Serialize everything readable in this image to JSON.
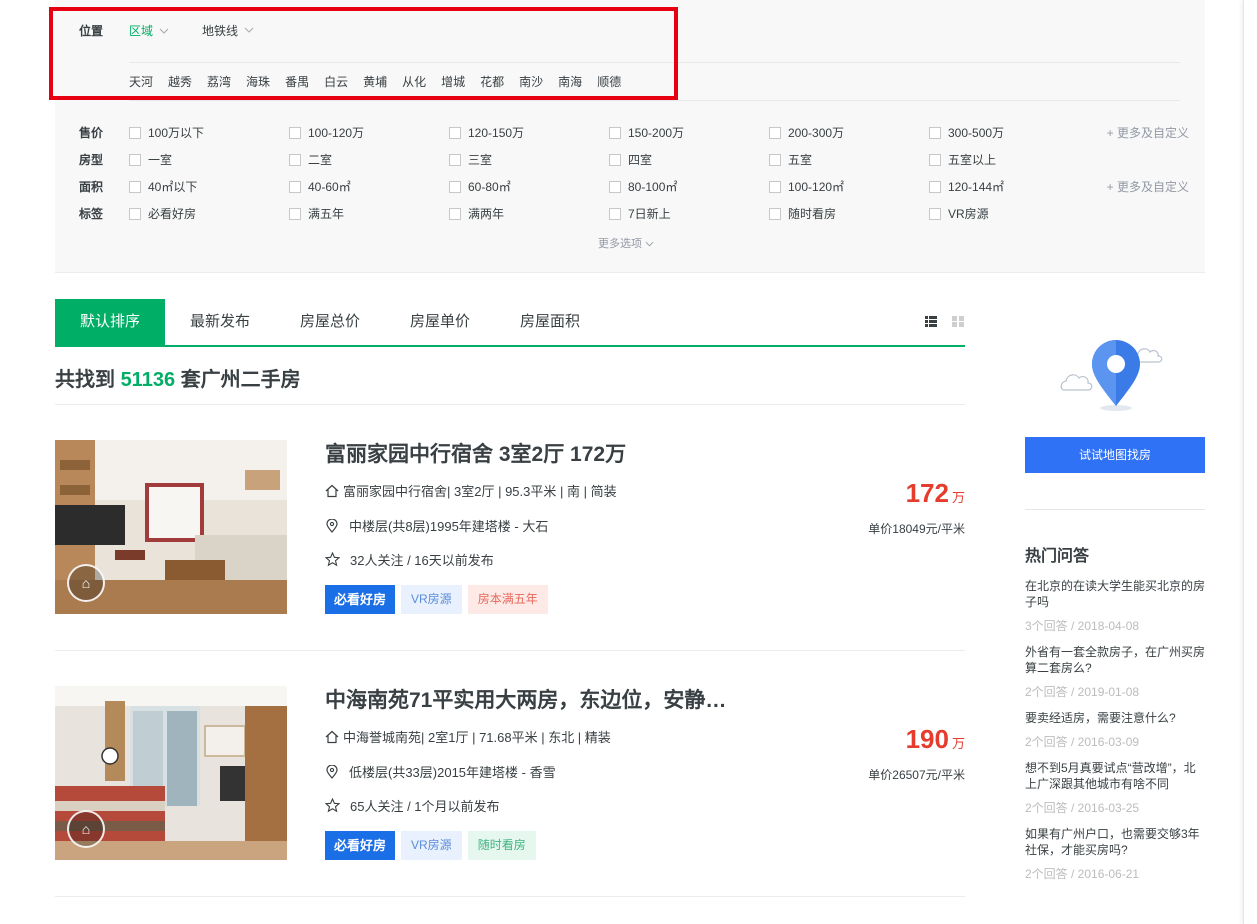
{
  "filter": {
    "location_label": "位置",
    "tabs": [
      {
        "label": "区域",
        "active": true
      },
      {
        "label": "地铁线",
        "active": false
      }
    ],
    "districts": [
      "天河",
      "越秀",
      "荔湾",
      "海珠",
      "番禺",
      "白云",
      "黄埔",
      "从化",
      "增城",
      "花都",
      "南沙",
      "南海",
      "顺德"
    ],
    "rows": [
      {
        "label": "售价",
        "options": [
          "100万以下",
          "100-120万",
          "120-150万",
          "150-200万",
          "200-300万",
          "300-500万"
        ],
        "more": "+ 更多及自定义"
      },
      {
        "label": "房型",
        "options": [
          "一室",
          "二室",
          "三室",
          "四室",
          "五室",
          "五室以上"
        ],
        "more": ""
      },
      {
        "label": "面积",
        "options": [
          "40㎡以下",
          "40-60㎡",
          "60-80㎡",
          "80-100㎡",
          "100-120㎡",
          "120-144㎡"
        ],
        "more": "+ 更多及自定义"
      },
      {
        "label": "标签",
        "options": [
          "必看好房",
          "满五年",
          "满两年",
          "7日新上",
          "随时看房",
          "VR房源"
        ],
        "more": ""
      }
    ],
    "more_options": "更多选项"
  },
  "sort": {
    "tabs": [
      {
        "label": "默认排序",
        "active": true
      },
      {
        "label": "最新发布",
        "active": false
      },
      {
        "label": "房屋总价",
        "active": false
      },
      {
        "label": "房屋单价",
        "active": false
      },
      {
        "label": "房屋面积",
        "active": false
      }
    ]
  },
  "summary": {
    "prefix": "共找到",
    "count": "51136",
    "suffix": "套广州二手房"
  },
  "listings": [
    {
      "title": "富丽家园中行宿舍 3室2厅 172万",
      "community": "富丽家园中行宿舍",
      "house_info": " | 3室2厅 | 95.3平米 | 南 | 简装",
      "position": "中楼层(共8层)1995年建塔楼 - 大石",
      "follow": "32人关注 / 16天以前发布",
      "tags": [
        {
          "text": "必看好房",
          "kind": "good"
        },
        {
          "text": "VR房源",
          "kind": "vr"
        },
        {
          "text": "房本满五年",
          "kind": "tax"
        }
      ],
      "price": "172",
      "price_unit": "万",
      "unit_price": "单价18049元/平米"
    },
    {
      "title": "中海南苑71平实用大两房，东边位，安静…",
      "community": "中海誉城南苑",
      "house_info": " | 2室1厅 | 71.68平米 | 东北 | 精装",
      "position": "低楼层(共33层)2015年建塔楼 - 香雪",
      "follow": "65人关注 / 1个月以前发布",
      "tags": [
        {
          "text": "必看好房",
          "kind": "good"
        },
        {
          "text": "VR房源",
          "kind": "vr"
        },
        {
          "text": "随时看房",
          "kind": "anytime"
        }
      ],
      "price": "190",
      "price_unit": "万",
      "unit_price": "单价26507元/平米"
    }
  ],
  "sidebar": {
    "map_button": "试试地图找房",
    "qa_title": "热门问答",
    "qa": [
      {
        "q": "在北京的在读大学生能买北京的房子吗",
        "meta": "3个回答 / 2018-04-08"
      },
      {
        "q": "外省有一套全款房子，在广州买房算二套房么?",
        "meta": "2个回答 / 2019-01-08"
      },
      {
        "q": "要卖经适房，需要注意什么?",
        "meta": "2个回答 / 2016-03-09"
      },
      {
        "q": "想不到5月真要试点“营改增”，北上广深跟其他城市有啥不同",
        "meta": "2个回答 / 2016-03-25"
      },
      {
        "q": "如果有广州户口，也需要交够3年社保，才能买房吗?",
        "meta": "2个回答 / 2016-06-21"
      }
    ]
  },
  "colors": {
    "brand_green": "#00ae66",
    "price_red": "#e53c2e",
    "map_blue": "#3072f6",
    "highlight_red": "#e60012"
  }
}
